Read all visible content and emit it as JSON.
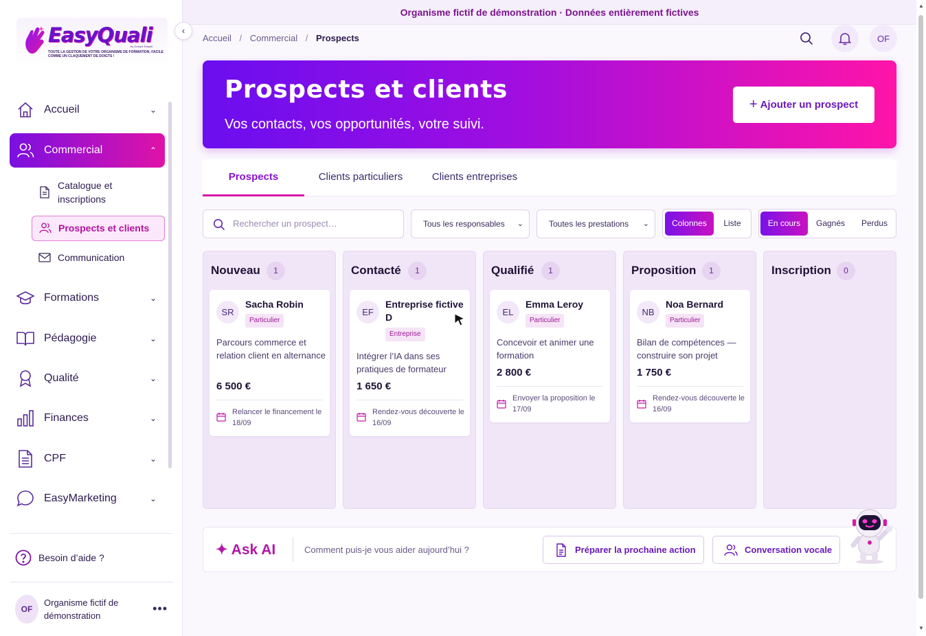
{
  "banner": {
    "text": "Organisme fictif de démonstration · Données entièrement fictives"
  },
  "logo": {
    "name": "EasyQuali",
    "by": "by Groupe EasyAI",
    "tagline": "Toute la gestion de votre organisme de formation, facile comme un claquement de doigts !"
  },
  "sidebar": {
    "collapse": "‹",
    "items": [
      {
        "label": "Accueil",
        "icon": "home-icon"
      },
      {
        "label": "Commercial",
        "icon": "users-icon"
      },
      {
        "label": "Formations",
        "icon": "graduation-cap-icon"
      },
      {
        "label": "Pédagogie",
        "icon": "book-open-icon"
      },
      {
        "label": "Qualité",
        "icon": "award-icon"
      },
      {
        "label": "Finances",
        "icon": "bar-chart-icon"
      },
      {
        "label": "CPF",
        "icon": "document-icon"
      },
      {
        "label": "EasyMarketing",
        "icon": "chat-bubble-icon"
      }
    ],
    "subitems": [
      {
        "label": "Catalogue et inscriptions",
        "icon": "document-icon"
      },
      {
        "label": "Prospects et clients",
        "icon": "users-icon"
      },
      {
        "label": "Communication",
        "icon": "mail-icon"
      }
    ],
    "help": "Besoin d’aide ?",
    "org": {
      "initials": "OF",
      "name": "Organisme fictif de démonstration",
      "menu": "•••"
    }
  },
  "breadcrumb": {
    "items": [
      "Accueil",
      "Commercial"
    ],
    "current": "Prospects",
    "separator": "/"
  },
  "header": {
    "avatar": "OF"
  },
  "hero": {
    "title": "Prospects et clients",
    "subtitle": "Vos contacts, vos opportunités, votre suivi.",
    "add_button": "Ajouter un prospect"
  },
  "tabs": [
    {
      "label": "Prospects",
      "active": true
    },
    {
      "label": "Clients particuliers",
      "active": false
    },
    {
      "label": "Clients entreprises",
      "active": false
    }
  ],
  "filters": {
    "search_placeholder": "Rechercher un prospect…",
    "responsables": "Tous les responsables",
    "prestations": "Toutes les prestations",
    "view": {
      "options": [
        "Colonnes",
        "Liste"
      ],
      "selected": "Colonnes"
    },
    "status": {
      "options": [
        "En cours",
        "Gagnés",
        "Perdus"
      ],
      "selected": "En cours"
    }
  },
  "columns": [
    {
      "title": "Nouveau",
      "count": "1",
      "cards": [
        {
          "initials": "SR",
          "name": "Sacha Robin",
          "tag": "Particulier",
          "desc": "Parcours commerce et relation client en alternance",
          "amount": "6 500 €",
          "action": "Relancer le financement le 18/09"
        }
      ]
    },
    {
      "title": "Contacté",
      "count": "1",
      "cards": [
        {
          "initials": "EF",
          "name": "Entreprise fictive D",
          "tag": "Entreprise",
          "desc": "Intégrer l’IA dans ses pratiques de formateur",
          "amount": "1 650 €",
          "action": "Rendez-vous découverte le 16/09"
        }
      ]
    },
    {
      "title": "Qualifié",
      "count": "1",
      "cards": [
        {
          "initials": "EL",
          "name": "Emma Leroy",
          "tag": "Particulier",
          "desc": "Concevoir et animer une formation",
          "amount": "2 800 €",
          "action": "Envoyer la proposition le 17/09"
        }
      ]
    },
    {
      "title": "Proposition",
      "count": "1",
      "cards": [
        {
          "initials": "NB",
          "name": "Noa Bernard",
          "tag": "Particulier",
          "desc": "Bilan de compétences — construire son projet",
          "amount": "1 750 €",
          "action": "Rendez-vous découverte le 16/09"
        }
      ]
    },
    {
      "title": "Inscription",
      "count": "0",
      "cards": []
    }
  ],
  "askai": {
    "brand": "✦ Ask AI",
    "prompt": "Comment puis-je vous aider aujourd’hui ?",
    "btn1": "Préparer la prochaine action",
    "btn2": "Conversation vocale"
  },
  "colors": {
    "primary": "#7a10e0",
    "accent": "#e012a8",
    "text": "#2a1a4a"
  }
}
